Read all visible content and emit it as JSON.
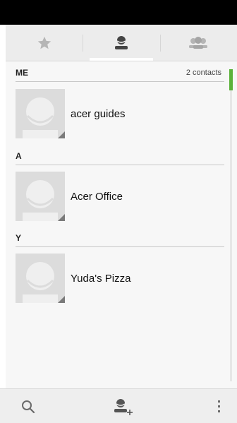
{
  "tabs": [
    {
      "name": "favorites",
      "icon": "star-icon"
    },
    {
      "name": "contacts",
      "icon": "person-icon",
      "active": true
    },
    {
      "name": "groups",
      "icon": "group-icon"
    }
  ],
  "sections": [
    {
      "letter": "ME",
      "count": "2 contacts"
    },
    {
      "letter": "A"
    },
    {
      "letter": "Y"
    }
  ],
  "contacts": [
    {
      "name": "acer guides"
    },
    {
      "name": "Acer Office"
    },
    {
      "name": "Yuda's Pizza"
    }
  ],
  "bottom_bar": {
    "icons": [
      "search-icon",
      "add-contact-icon",
      "overflow-menu-icon"
    ]
  },
  "colors": {
    "scroll_accent": "#5bb23a",
    "active_icon": "#444444",
    "inactive_icon": "#b5b5b5"
  }
}
